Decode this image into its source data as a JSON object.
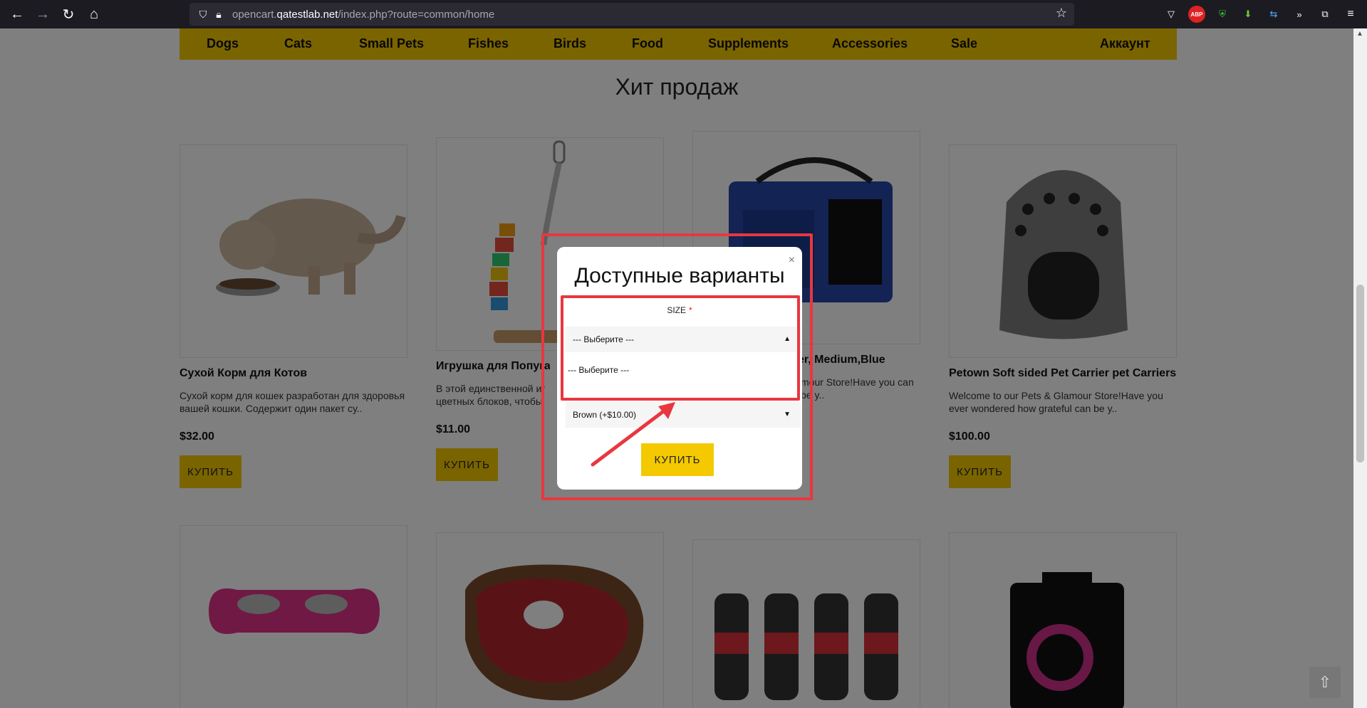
{
  "browser": {
    "url_prefix": "opencart.",
    "url_domain": "qatestlab.net",
    "url_path": "/index.php?route=common/home"
  },
  "menu": {
    "items": [
      "Dogs",
      "Cats",
      "Small Pets",
      "Fishes",
      "Birds",
      "Food",
      "Supplements",
      "Accessories",
      "Sale"
    ],
    "account": "Аккаунт"
  },
  "section_title": "Хит продаж",
  "products": [
    {
      "name": "Сухой Корм для Котов",
      "desc": "Сухой корм для кошек разработан для здоровья вашей кошки. Содержит один пакет су..",
      "price": "$32.00",
      "buy": "КУПИТЬ"
    },
    {
      "name": "Игрушка для Попуга",
      "desc": "В этой единственной иг цветных блоков, чтобы",
      "price": "$11.00",
      "buy": "КУПИТЬ"
    },
    {
      "name": "er, Medium,Blue",
      "desc": "mour Store!Have you can be y..",
      "price": "",
      "buy": ""
    },
    {
      "name": "Petown Soft sided Pet Carrier pet Carriers ...",
      "desc": "Welcome to our Pets & Glamour Store!Have you ever wondered how grateful can be y..",
      "price": "$100.00",
      "buy": "КУПИТЬ"
    }
  ],
  "modal": {
    "title": "Доступные варианты",
    "close": "×",
    "size_label": "SIZE",
    "required_mark": "*",
    "select_value": "--- Выберите ---",
    "dropdown_option": "--- Выберите ---",
    "color_select_value": "Brown (+$10.00)",
    "buy_label": "КУПИТЬ"
  },
  "colors": {
    "accent": "#f4c900",
    "highlight": "#e8373f"
  }
}
